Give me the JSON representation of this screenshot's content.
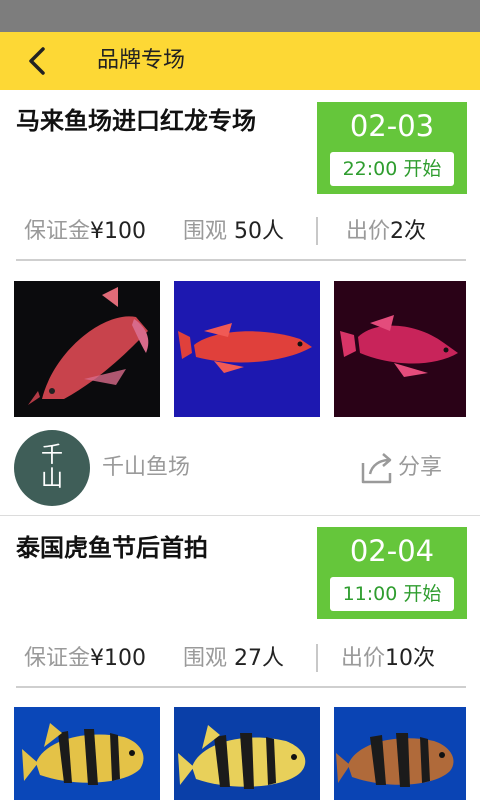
{
  "header": {
    "title": "品牌专场"
  },
  "auctions": [
    {
      "title": "马来鱼场进口红龙专场",
      "date": "02-03",
      "start_time": "22:00 开始",
      "deposit_label": "保证金",
      "deposit_value": "¥100",
      "watch_label": "围观",
      "watch_value": "50人",
      "bid_label": "出价",
      "bid_value": "2次",
      "shop_name": "千山鱼场",
      "shop_avatar_char_1": "千",
      "shop_avatar_char_2": "山",
      "share_label": "分享",
      "images": [
        "red-arowana-fish",
        "red-arowana-fish",
        "red-arowana-fish"
      ]
    },
    {
      "title": "泰国虎鱼节后首拍",
      "date": "02-04",
      "start_time": "11:00 开始",
      "deposit_label": "保证金",
      "deposit_value": "¥100",
      "watch_label": "围观",
      "watch_value": "27人",
      "bid_label": "出价",
      "bid_value": "10次",
      "images": [
        "tiger-fish",
        "tiger-fish",
        "tiger-fish"
      ]
    }
  ],
  "colors": {
    "status_bar": "#7d7d7d",
    "nav_bar": "#fdd835",
    "date_box": "#65c63b",
    "time_text": "#2f9d2f",
    "avatar_bg": "#3f5e58"
  }
}
